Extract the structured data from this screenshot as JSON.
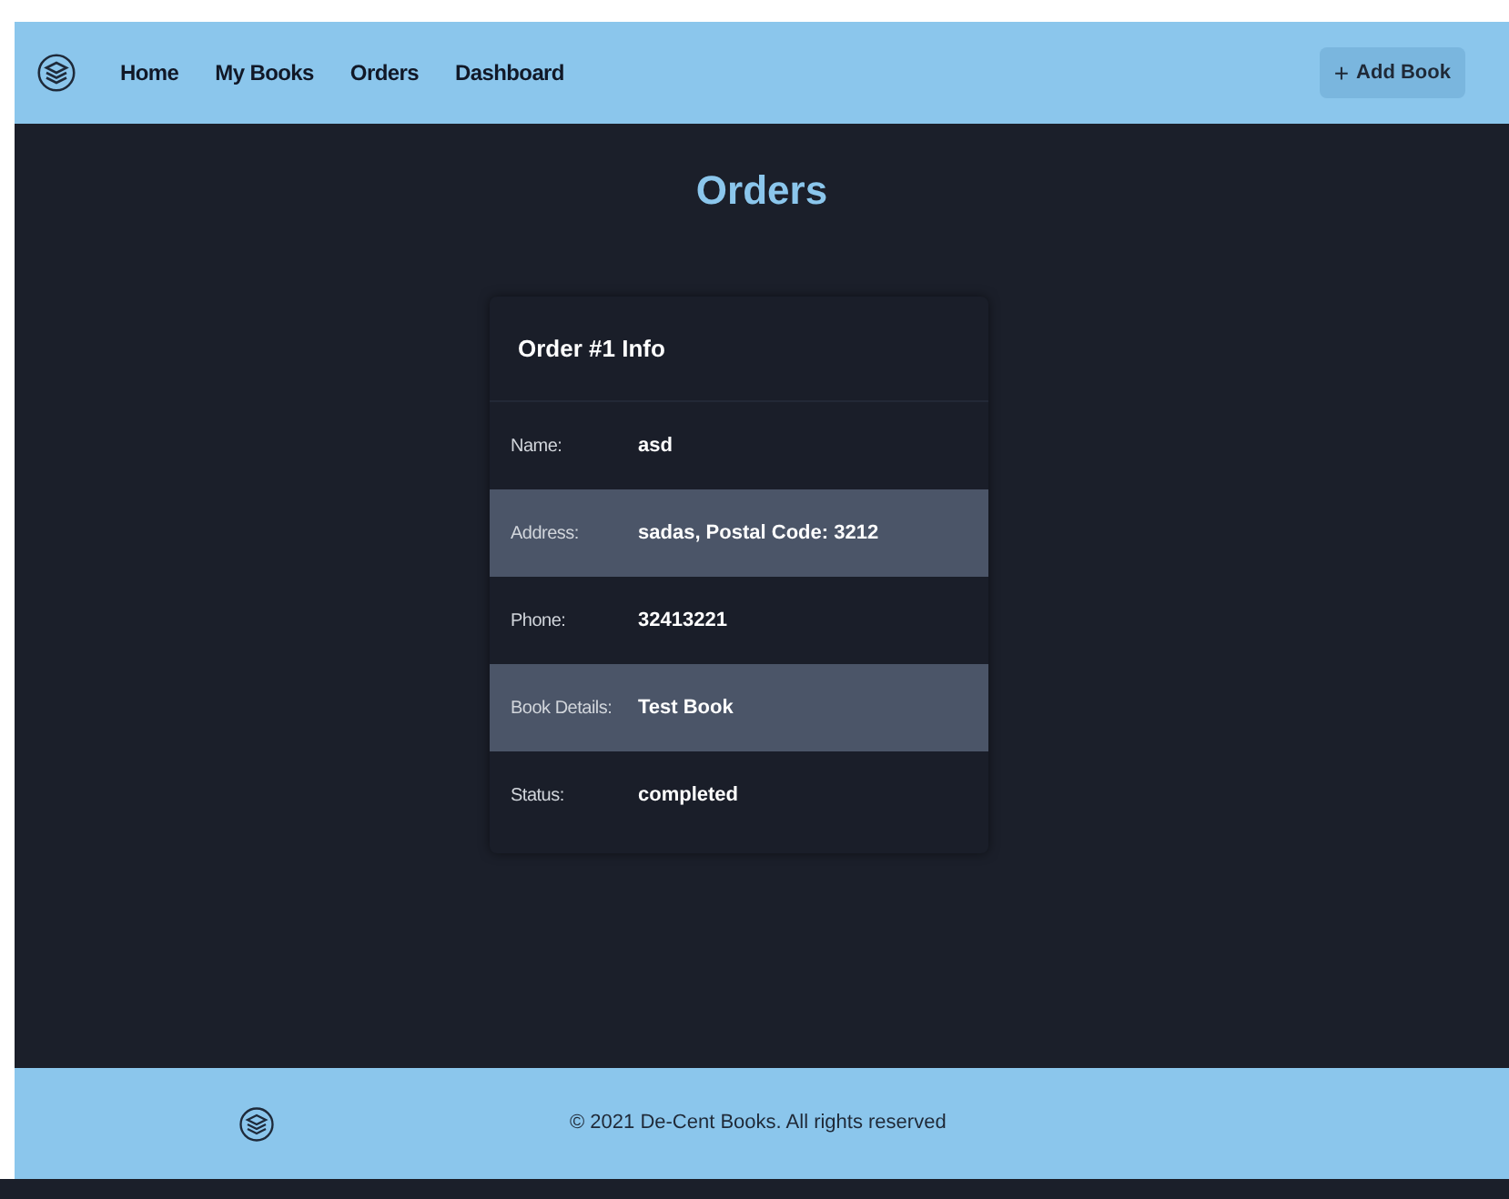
{
  "nav": {
    "links": [
      "Home",
      "My Books",
      "Orders",
      "Dashboard"
    ],
    "action": {
      "icon": "+",
      "label": "Add Book"
    }
  },
  "page_title": "Orders",
  "order_card": {
    "title": "Order #1 Info",
    "fields": [
      {
        "label": "Name:",
        "value": "asd"
      },
      {
        "label": "Address:",
        "value": "sadas, Postal Code: 3212"
      },
      {
        "label": "Phone:",
        "value": "32413221"
      },
      {
        "label": "Book Details:",
        "value": "Test Book"
      },
      {
        "label": "Status:",
        "value": "completed"
      }
    ]
  },
  "footer": {
    "copyright": "© 2021 De-Cent Books. All rights reserved"
  }
}
